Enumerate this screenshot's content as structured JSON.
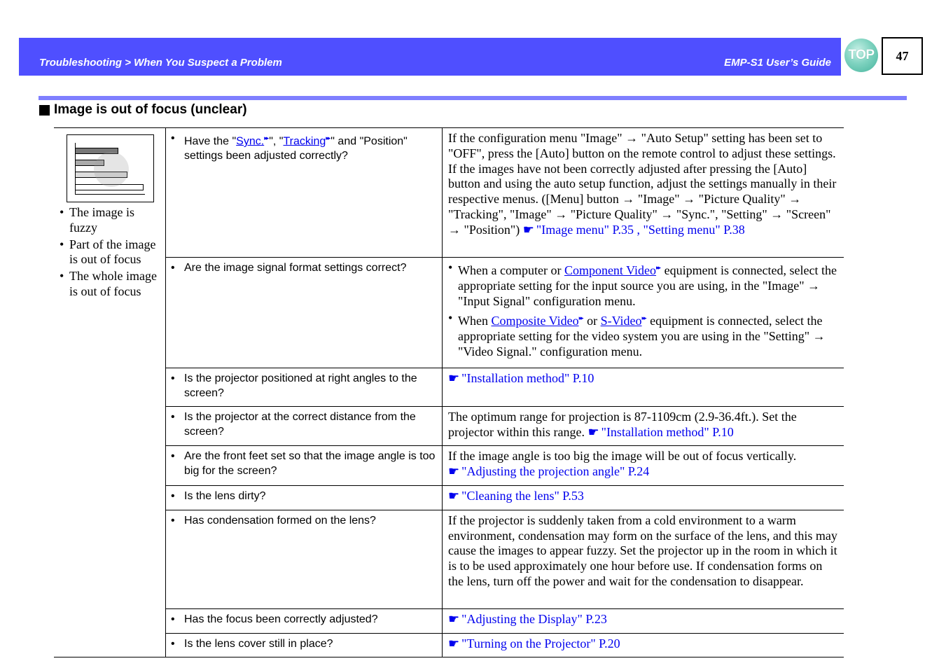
{
  "header": {
    "breadcrumb": "Troubleshooting > When You Suspect a Problem",
    "guide_title": "EMP-S1 User’s Guide",
    "top_button_label": "TOP",
    "page_number": "47",
    "colors": {
      "header_bar": "#4f4fff",
      "section_rule": "#7f7fff",
      "link": "#0000ee"
    }
  },
  "section": {
    "title": "Image is out of focus (unclear)"
  },
  "symptoms": [
    "The image is fuzzy",
    "Part of the image is out of focus",
    "The whole image is out of focus"
  ],
  "rows": [
    {
      "check": {
        "pre": "Have the \"",
        "link1": "Sync.",
        "mid": "\", \"",
        "link2": "Tracking",
        "post": "\" and \"Position\" settings been adjusted correctly?"
      },
      "remedy": {
        "text": "If the configuration menu \"Image\" → \"Auto Setup\" setting has been set to \"OFF\", press the [Auto] button on the remote control to adjust these settings. If the images have not been correctly adjusted after pressing the [Auto] button and using the auto setup function, adjust the settings manually in their respective menus. ([Menu] button → \"Image\" → \"Picture Quality\" → \"Tracking\", \"Image\" → \"Picture Quality\" → \"Sync.\", \"Setting\" → \"Screen\" → \"Position\")",
        "ref": "\"Image menu\" P.35 , \"Setting menu\" P.38"
      }
    },
    {
      "check": {
        "text": "Are the image signal format settings correct?"
      },
      "remedy": {
        "item1": {
          "pre": "When a computer or ",
          "link": "Component Video",
          "post": " equipment is connected, select the appropriate setting for the input source you are using, in the \"Image\" → \"Input Signal\" configuration menu."
        },
        "item2": {
          "pre": "When ",
          "link1": "Composite Video",
          "mid": " or ",
          "link2": "S-Video",
          "post": " equipment is connected, select the appropriate setting for the video system you are using in the \"Setting\" → \"Video Signal.\" configuration menu."
        }
      }
    },
    {
      "check": {
        "text": "Is the projector positioned at right angles to the screen?"
      },
      "remedy": {
        "text": "",
        "ref": "\"Installation method\" P.10"
      }
    },
    {
      "check": {
        "text": "Is the projector at the correct distance from the screen?"
      },
      "remedy": {
        "text": "The optimum range for projection is 87-1109cm (2.9-36.4ft.). Set the projector within this range.",
        "ref": "\"Installation method\" P.10"
      }
    },
    {
      "check": {
        "text": "Are the front feet set so that the image angle is too big for the screen?"
      },
      "remedy": {
        "text": "If the image angle is too big the image will be out of focus vertically.",
        "ref": "\"Adjusting the projection angle\" P.24"
      }
    },
    {
      "check": {
        "text": "Is the lens dirty?"
      },
      "remedy": {
        "text": "",
        "ref": "\"Cleaning the lens\" P.53"
      }
    },
    {
      "check": {
        "text": "Has condensation formed on the lens?"
      },
      "remedy": {
        "text": "If the projector is suddenly taken from a cold environment to a warm environment, condensation may form on the surface of the lens, and this may cause the images to appear fuzzy. Set the projector up in the room in which it is to be used approximately one hour before use. If condensation forms on the lens, turn off the power and wait for the condensation to disappear.",
        "ref": ""
      }
    },
    {
      "check": {
        "text": "Has the focus been correctly adjusted?"
      },
      "remedy": {
        "text": "",
        "ref": "\"Adjusting the Display\" P.23"
      }
    },
    {
      "check": {
        "text": "Is the lens cover still in place?"
      },
      "remedy": {
        "text": "",
        "ref": "\"Turning on the Projector\" P.20"
      }
    }
  ],
  "icons": {
    "bullet": "•",
    "glossary": "▸▸",
    "hand": "☛",
    "section_square": "■"
  }
}
